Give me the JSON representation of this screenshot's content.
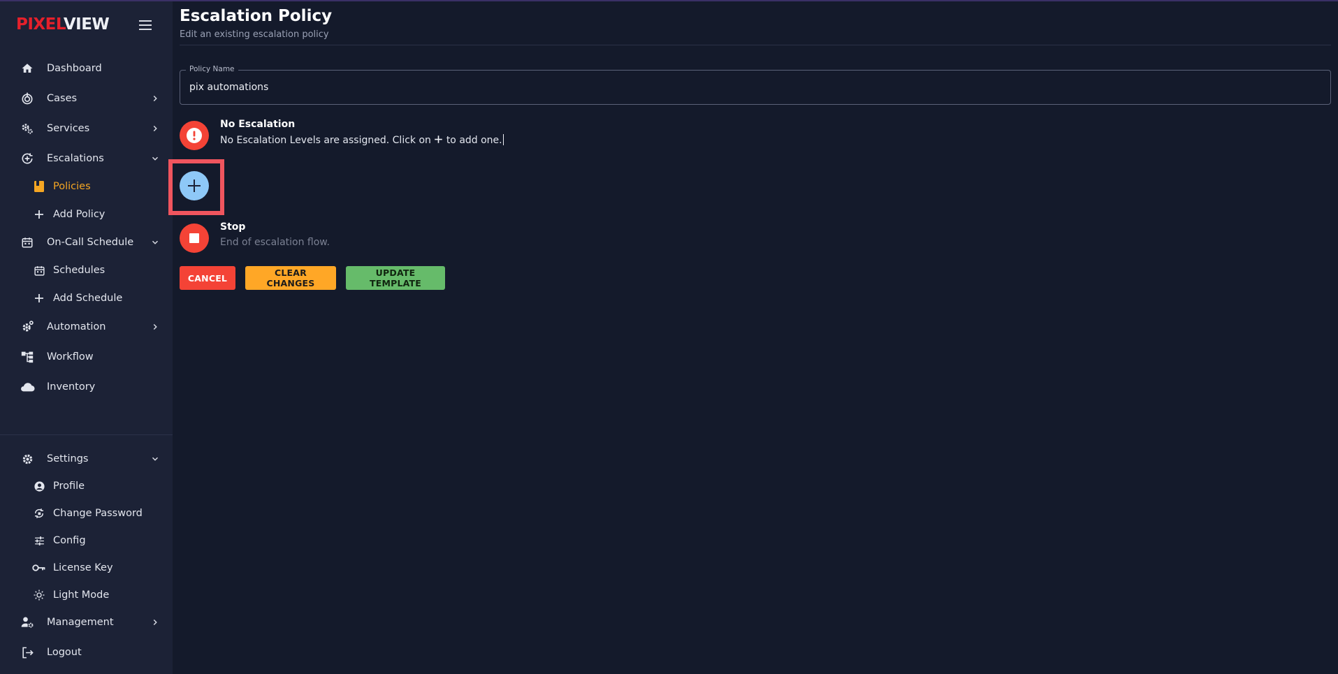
{
  "brand": {
    "part1": "PIXEL",
    "part2": "VIEW"
  },
  "sidebar": {
    "items": [
      {
        "label": "Dashboard"
      },
      {
        "label": "Cases"
      },
      {
        "label": "Services"
      },
      {
        "label": "Escalations"
      },
      {
        "label": "Policies"
      },
      {
        "label": "Add Policy"
      },
      {
        "label": "On-Call Schedule"
      },
      {
        "label": "Schedules"
      },
      {
        "label": "Add Schedule"
      },
      {
        "label": "Automation"
      },
      {
        "label": "Workflow"
      },
      {
        "label": "Inventory"
      },
      {
        "label": "Settings"
      },
      {
        "label": "Profile"
      },
      {
        "label": "Change Password"
      },
      {
        "label": "Config"
      },
      {
        "label": "License Key"
      },
      {
        "label": "Light Mode"
      },
      {
        "label": "Management"
      },
      {
        "label": "Logout"
      }
    ]
  },
  "header": {
    "title": "Escalation Policy",
    "subtitle": "Edit an existing escalation policy"
  },
  "form": {
    "policy_name_label": "Policy Name",
    "policy_name_value": "pix automations"
  },
  "steps": {
    "no_escalation_title": "No Escalation",
    "no_escalation_text_before": "No Escalation Levels are assigned. Click on",
    "no_escalation_text_after": "to add one.",
    "stop_title": "Stop",
    "stop_text": "End of escalation flow."
  },
  "buttons": {
    "cancel": "CANCEL",
    "clear": "CLEAR CHANGES",
    "update": "UPDATE TEMPLATE"
  },
  "colors": {
    "accent_active": "#f5a623",
    "danger": "#f44336",
    "warning": "#ffa726",
    "success": "#66bb6a",
    "add_button": "#8ec8f7"
  }
}
